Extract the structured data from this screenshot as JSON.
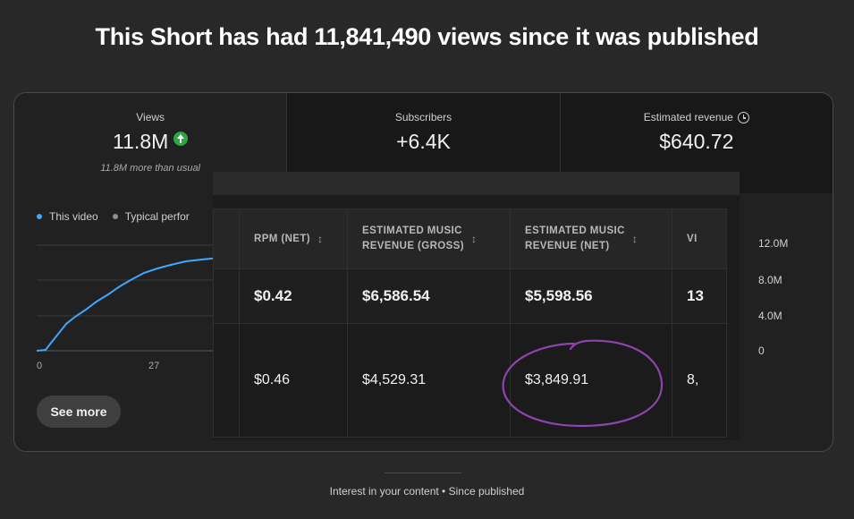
{
  "headline": "This Short has had 11,841,490 views since it was published",
  "stats": {
    "views": {
      "label": "Views",
      "value": "11.8M",
      "sub": "11.8M more than usual"
    },
    "subscribers": {
      "label": "Subscribers",
      "value": "+6.4K"
    },
    "revenue": {
      "label": "Estimated revenue",
      "value": "$640.72"
    }
  },
  "legend": {
    "this_video": "This video",
    "typical": "Typical perfor"
  },
  "x_ticks": [
    "0",
    "27"
  ],
  "see_more": "See more",
  "y_ticks": [
    "12.0M",
    "8.0M",
    "4.0M",
    "0"
  ],
  "table": {
    "headers": [
      {
        "line1": "RPM (NET)",
        "line2": ""
      },
      {
        "line1": "ESTIMATED MUSIC",
        "line2": "REVENUE (GROSS)"
      },
      {
        "line1": "ESTIMATED MUSIC",
        "line2": "REVENUE (NET)"
      },
      {
        "line1": "VI",
        "line2": ""
      }
    ],
    "rows": [
      [
        "$0.42",
        "$6,586.54",
        "$5,598.56",
        "13"
      ],
      [
        "$0.46",
        "$4,529.31",
        "$3,849.91",
        "8,"
      ]
    ]
  },
  "footer": "Interest in your content • Since published",
  "colors": {
    "accent_line": "#3ea6ff",
    "up_icon": "#2ba640",
    "annotation": "#8e44ad"
  }
}
